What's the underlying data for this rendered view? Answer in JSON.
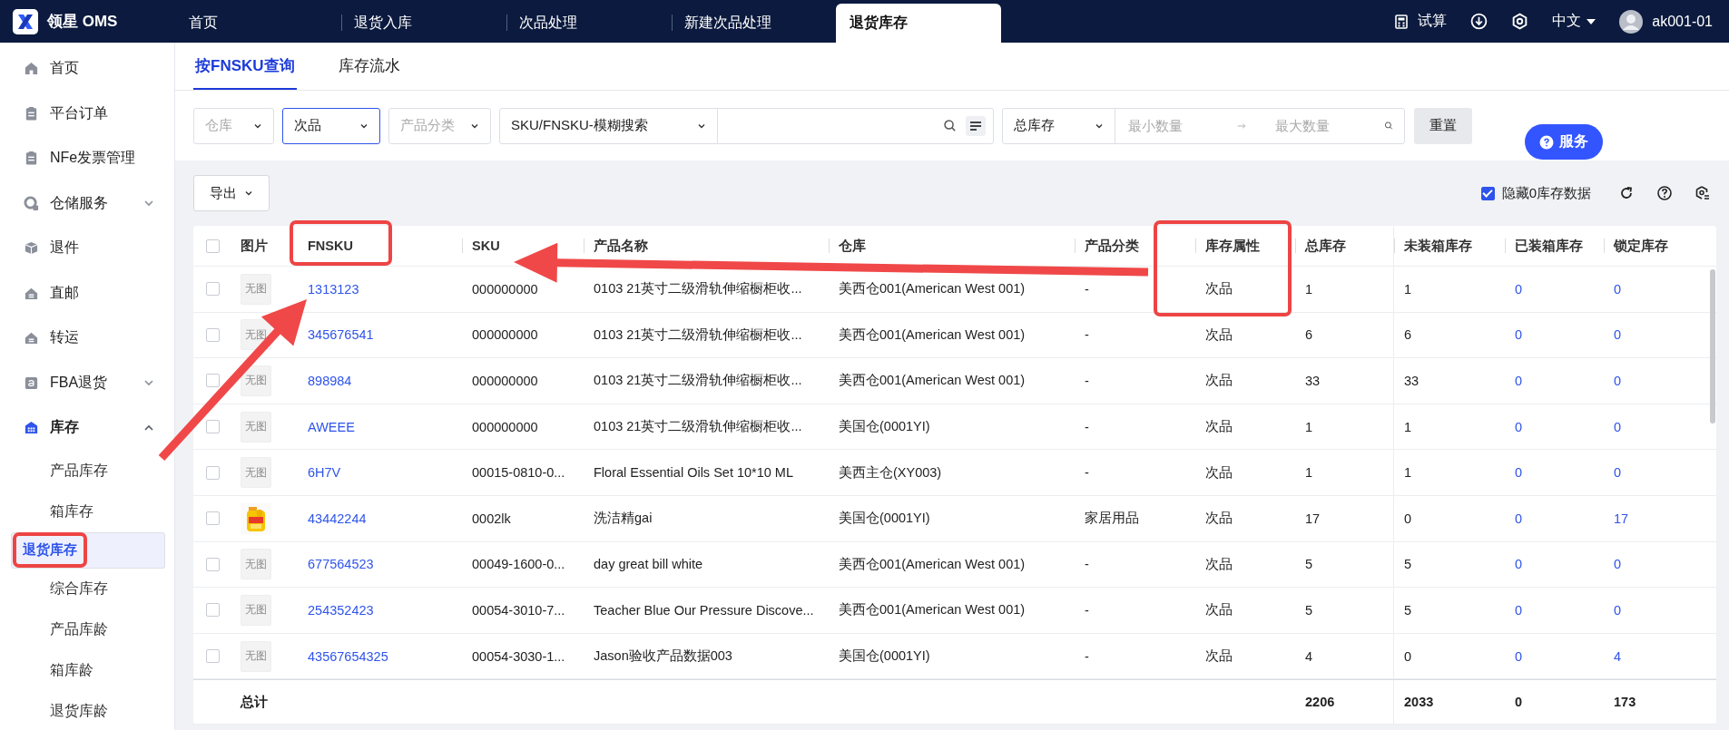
{
  "app": {
    "logo_text": "领星 OMS"
  },
  "top_tabs": [
    {
      "label": "首页",
      "selected": false
    },
    {
      "label": "退货入库",
      "selected": false
    },
    {
      "label": "次品处理",
      "selected": false
    },
    {
      "label": "新建次品处理",
      "selected": false
    },
    {
      "label": "退货库存",
      "selected": true
    }
  ],
  "top_actions": {
    "calculator": "试算",
    "language": "中文",
    "user": "ak001-01"
  },
  "sidebar": {
    "items": [
      {
        "label": "首页"
      },
      {
        "label": "平台订单"
      },
      {
        "label": "NFe发票管理"
      },
      {
        "label": "仓储服务",
        "expanded": false
      },
      {
        "label": "退件"
      },
      {
        "label": "直邮"
      },
      {
        "label": "转运"
      },
      {
        "label": "FBA退货",
        "expanded": false
      },
      {
        "label": "库存",
        "expanded": true,
        "children": [
          {
            "label": "产品库存",
            "selected": false,
            "annotated": false
          },
          {
            "label": "箱库存",
            "selected": false,
            "annotated": false
          },
          {
            "label": "退货库存",
            "selected": true,
            "annotated": true
          },
          {
            "label": "综合库存",
            "selected": false,
            "annotated": false
          },
          {
            "label": "产品库龄",
            "selected": false,
            "annotated": false
          },
          {
            "label": "箱库龄",
            "selected": false,
            "annotated": false
          },
          {
            "label": "退货库龄",
            "selected": false,
            "annotated": false
          }
        ]
      }
    ]
  },
  "page_tabs": [
    {
      "label": "按FNSKU查询",
      "selected": true
    },
    {
      "label": "库存流水",
      "selected": false
    }
  ],
  "filters": {
    "warehouse": {
      "placeholder": "仓库"
    },
    "attribute": {
      "value": "次品",
      "focused": true
    },
    "category": {
      "placeholder": "产品分类"
    },
    "search_type": {
      "value": "SKU/FNSKU-模糊搜索"
    },
    "stock_type": {
      "value": "总库存"
    },
    "min": {
      "placeholder": "最小数量"
    },
    "max": {
      "placeholder": "最大数量"
    },
    "reset": "重置"
  },
  "service_button": "服务",
  "toolbar": {
    "export": "导出",
    "hide_zero": {
      "label": "隐藏0库存数据",
      "checked": true
    }
  },
  "table": {
    "select_all": {
      "checked": false
    },
    "columns": [
      {
        "label": "图片",
        "kind": "picture"
      },
      {
        "label": "FNSKU",
        "annotated": true,
        "kind": "link"
      },
      {
        "label": "SKU",
        "kind": "text"
      },
      {
        "label": "产品名称",
        "kind": "text"
      },
      {
        "label": "仓库",
        "kind": "text"
      },
      {
        "label": "产品分类",
        "kind": "text"
      },
      {
        "label": "库存属性",
        "annotated": true,
        "kind": "text"
      },
      {
        "label": "总库存",
        "kind": "text"
      },
      {
        "label": "未装箱库存",
        "kind": "text"
      },
      {
        "label": "已装箱库存",
        "kind": "link"
      },
      {
        "label": "锁定库存",
        "kind": "link"
      }
    ],
    "rows": [
      {
        "checked": false,
        "kind": "placeholder",
        "cells": [
          "无图",
          "1313123",
          "000000000",
          "0103 21英寸二级滑轨伸缩橱柜收...",
          "美西仓001(American West 001)",
          "-",
          "次品",
          "1",
          "1",
          "0",
          "0"
        ]
      },
      {
        "checked": false,
        "kind": "placeholder",
        "cells": [
          "无图",
          "345676541",
          "000000000",
          "0103 21英寸二级滑轨伸缩橱柜收...",
          "美西仓001(American West 001)",
          "-",
          "次品",
          "6",
          "6",
          "0",
          "0"
        ]
      },
      {
        "checked": false,
        "kind": "placeholder",
        "cells": [
          "无图",
          "898984",
          "000000000",
          "0103 21英寸二级滑轨伸缩橱柜收...",
          "美西仓001(American West 001)",
          "-",
          "次品",
          "33",
          "33",
          "0",
          "0"
        ]
      },
      {
        "checked": false,
        "kind": "placeholder",
        "cells": [
          "无图",
          "AWEEE",
          "000000000",
          "0103 21英寸二级滑轨伸缩橱柜收...",
          "美国仓(0001YI)",
          "-",
          "次品",
          "1",
          "1",
          "0",
          "0"
        ]
      },
      {
        "checked": false,
        "kind": "placeholder",
        "cells": [
          "无图",
          "6H7V",
          "00015-0810-0...",
          "Floral Essential Oils Set 10*10 ML",
          "美西主仓(XY003)",
          "-",
          "次品",
          "1",
          "1",
          "0",
          "0"
        ]
      },
      {
        "checked": false,
        "kind": "picture",
        "cells": [
          "",
          "43442244",
          "0002lk",
          "洗洁精gai",
          "美国仓(0001YI)",
          "家居用品",
          "次品",
          "17",
          "0",
          "0",
          "17"
        ]
      },
      {
        "checked": false,
        "kind": "placeholder",
        "cells": [
          "无图",
          "677564523",
          "00049-1600-0...",
          "day great bill white",
          "美西仓001(American West 001)",
          "-",
          "次品",
          "5",
          "5",
          "0",
          "0"
        ]
      },
      {
        "checked": false,
        "kind": "placeholder",
        "cells": [
          "无图",
          "254352423",
          "00054-3010-7...",
          "Teacher Blue Our Pressure Discove...",
          "美西仓001(American West 001)",
          "-",
          "次品",
          "5",
          "5",
          "0",
          "0"
        ]
      },
      {
        "checked": false,
        "kind": "placeholder",
        "cells": [
          "无图",
          "43567654325",
          "00054-3030-1...",
          "Jason验收产品数据003",
          "美国仓(0001YI)",
          "-",
          "次品",
          "4",
          "0",
          "0",
          "4"
        ]
      }
    ],
    "totals": {
      "cells": [
        "总计",
        "",
        "",
        "",
        "",
        "",
        "",
        "2206",
        "2033",
        "0",
        "173"
      ]
    }
  }
}
